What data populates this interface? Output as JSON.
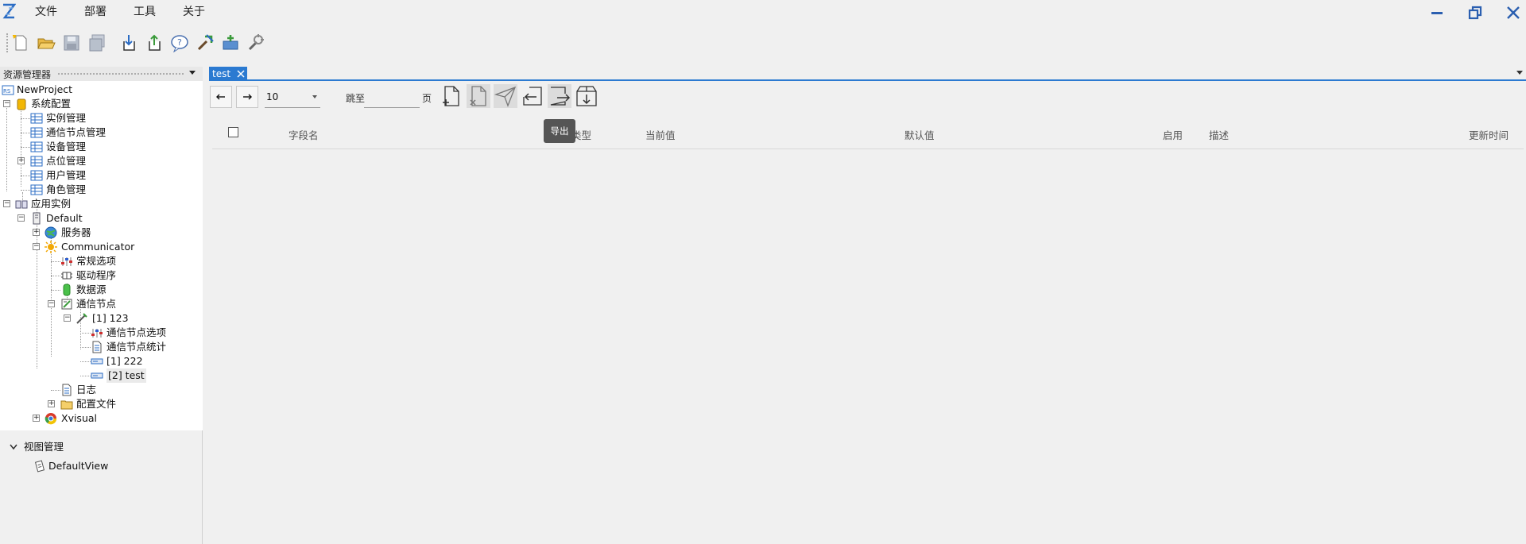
{
  "menubar": {
    "items": [
      "文件",
      "部署",
      "工具",
      "关于"
    ]
  },
  "toolbar": {
    "icons": [
      "new-file-icon",
      "open-folder-icon",
      "save-icon",
      "save-all-icon",
      "import-icon",
      "export-icon",
      "help-icon",
      "build-icon",
      "add-icon",
      "tools-icon"
    ]
  },
  "explorer": {
    "title": "资源管理器",
    "tree": {
      "project": "NewProject",
      "system_config": "系统配置",
      "instance_mgmt": "实例管理",
      "comm_node_mgmt": "通信节点管理",
      "device_mgmt": "设备管理",
      "point_mgmt": "点位管理",
      "user_mgmt": "用户管理",
      "role_mgmt": "角色管理",
      "app_instances": "应用实例",
      "default": "Default",
      "server": "服务器",
      "communicator": "Communicator",
      "general_options": "常规选项",
      "driver": "驱动程序",
      "datasource": "数据源",
      "comm_nodes": "通信节点",
      "node_123": "[1] 123",
      "node_options": "通信节点选项",
      "node_stats": "通信节点统计",
      "node_222": "[1] 222",
      "node_test": "[2] test",
      "log": "日志",
      "config_files": "配置文件",
      "xvisual": "Xvisual"
    }
  },
  "views": {
    "title": "视图管理",
    "default_view": "DefaultView"
  },
  "tab": {
    "label": "test"
  },
  "pager": {
    "page_size": "10",
    "jump_label": "跳至",
    "page_unit": "页",
    "jump_value": ""
  },
  "grid": {
    "columns": [
      "字段名",
      "类型",
      "当前值",
      "默认值",
      "启用",
      "描述",
      "更新时间"
    ]
  },
  "tooltip": {
    "text": "导出"
  },
  "colors": {
    "accent": "#2b7ad1",
    "background": "#f0f0f0"
  }
}
